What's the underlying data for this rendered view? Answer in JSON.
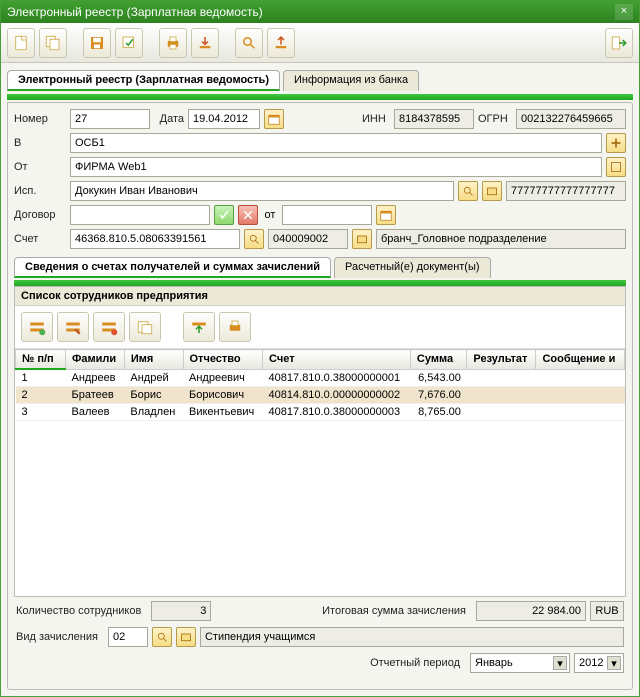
{
  "window": {
    "title": "Электронный реестр (Зарплатная ведомость)"
  },
  "tabs": {
    "main": "Электронный реестр (Зарплатная ведомость)",
    "bank": "Информация из банка"
  },
  "form": {
    "number_label": "Номер",
    "number": "27",
    "date_label": "Дата",
    "date": "19.04.2012",
    "inn_label": "ИНН",
    "inn": "8184378595",
    "ogrn_label": "ОГРН",
    "ogrn": "002132276459665",
    "v_label": "В",
    "v": "ОСБ1",
    "from_label": "От",
    "from": "ФИРМА Web1",
    "isp_label": "Исп.",
    "isp": "Докукин Иван Иванович",
    "isp_extra": "77777777777777777",
    "contract_label": "Договор",
    "contract": "",
    "ot_label": "от",
    "contract_date": "",
    "account_label": "Счет",
    "account": "46368.810.5.08063391561",
    "account2": "040009002",
    "branch": "бранч_Головное подразделение"
  },
  "subtabs": {
    "accounts": "Сведения о счетах получателей и суммах зачислений",
    "docs": "Расчетный(е) документ(ы)"
  },
  "list": {
    "header": "Список сотрудников предприятия",
    "columns": {
      "npp": "№ п/п",
      "lastname": "Фамили",
      "firstname": "Имя",
      "patronymic": "Отчество",
      "account": "Счет",
      "sum": "Сумма",
      "result": "Результат",
      "message": "Сообщение и"
    },
    "rows": [
      {
        "n": "1",
        "ln": "Андреев",
        "fn": "Андрей",
        "pn": "Андреевич",
        "acc": "40817.810.0.38000000001",
        "sum": "6,543.00"
      },
      {
        "n": "2",
        "ln": "Братеев",
        "fn": "Борис",
        "pn": "Борисович",
        "acc": "40814.810.0.00000000002",
        "sum": "7,676.00"
      },
      {
        "n": "3",
        "ln": "Валеев",
        "fn": "Владлен",
        "pn": "Викентьевич",
        "acc": "40817.810.0.38000000003",
        "sum": "8,765.00"
      }
    ]
  },
  "footer": {
    "emp_count_label": "Количество сотрудников",
    "emp_count": "3",
    "total_label": "Итоговая сумма зачисления",
    "total": "22 984.00",
    "currency": "RUB",
    "type_label": "Вид зачисления",
    "type_code": "02",
    "type_text": "Стипендия учащимся",
    "period_label": "Отчетный период",
    "period_month": "Январь",
    "period_year": "2012"
  }
}
